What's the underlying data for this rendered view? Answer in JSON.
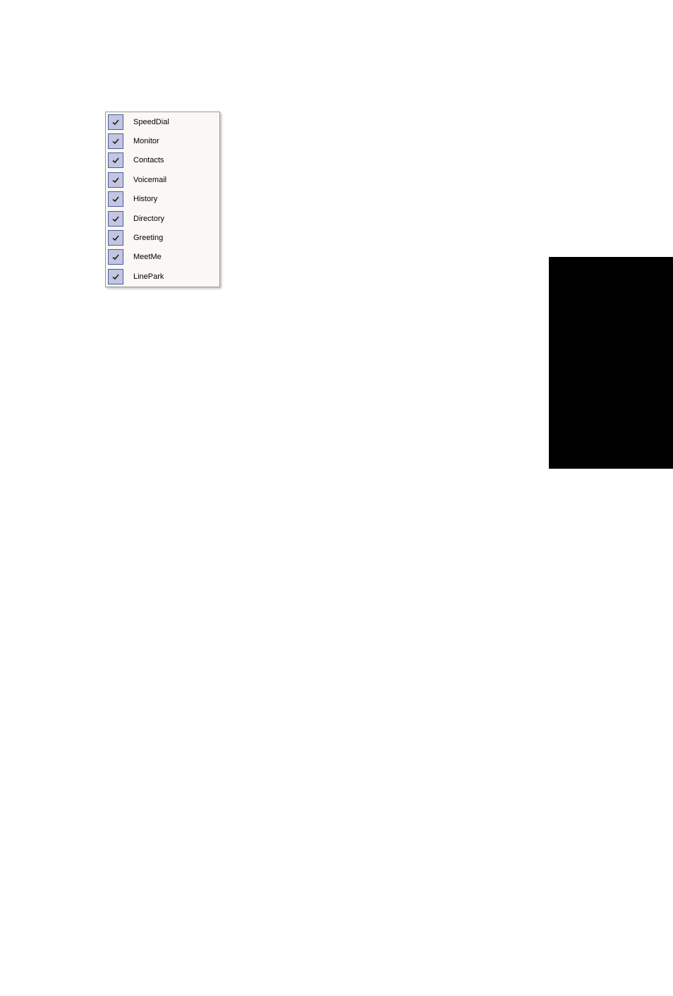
{
  "menu": {
    "items": [
      {
        "label": "SpeedDial",
        "checked": true
      },
      {
        "label": "Monitor",
        "checked": true
      },
      {
        "label": "Contacts",
        "checked": true
      },
      {
        "label": "Voicemail",
        "checked": true
      },
      {
        "label": "History",
        "checked": true
      },
      {
        "label": "Directory",
        "checked": true
      },
      {
        "label": "Greeting",
        "checked": true
      },
      {
        "label": "MeetMe",
        "checked": true
      },
      {
        "label": "LinePark",
        "checked": true
      }
    ]
  }
}
